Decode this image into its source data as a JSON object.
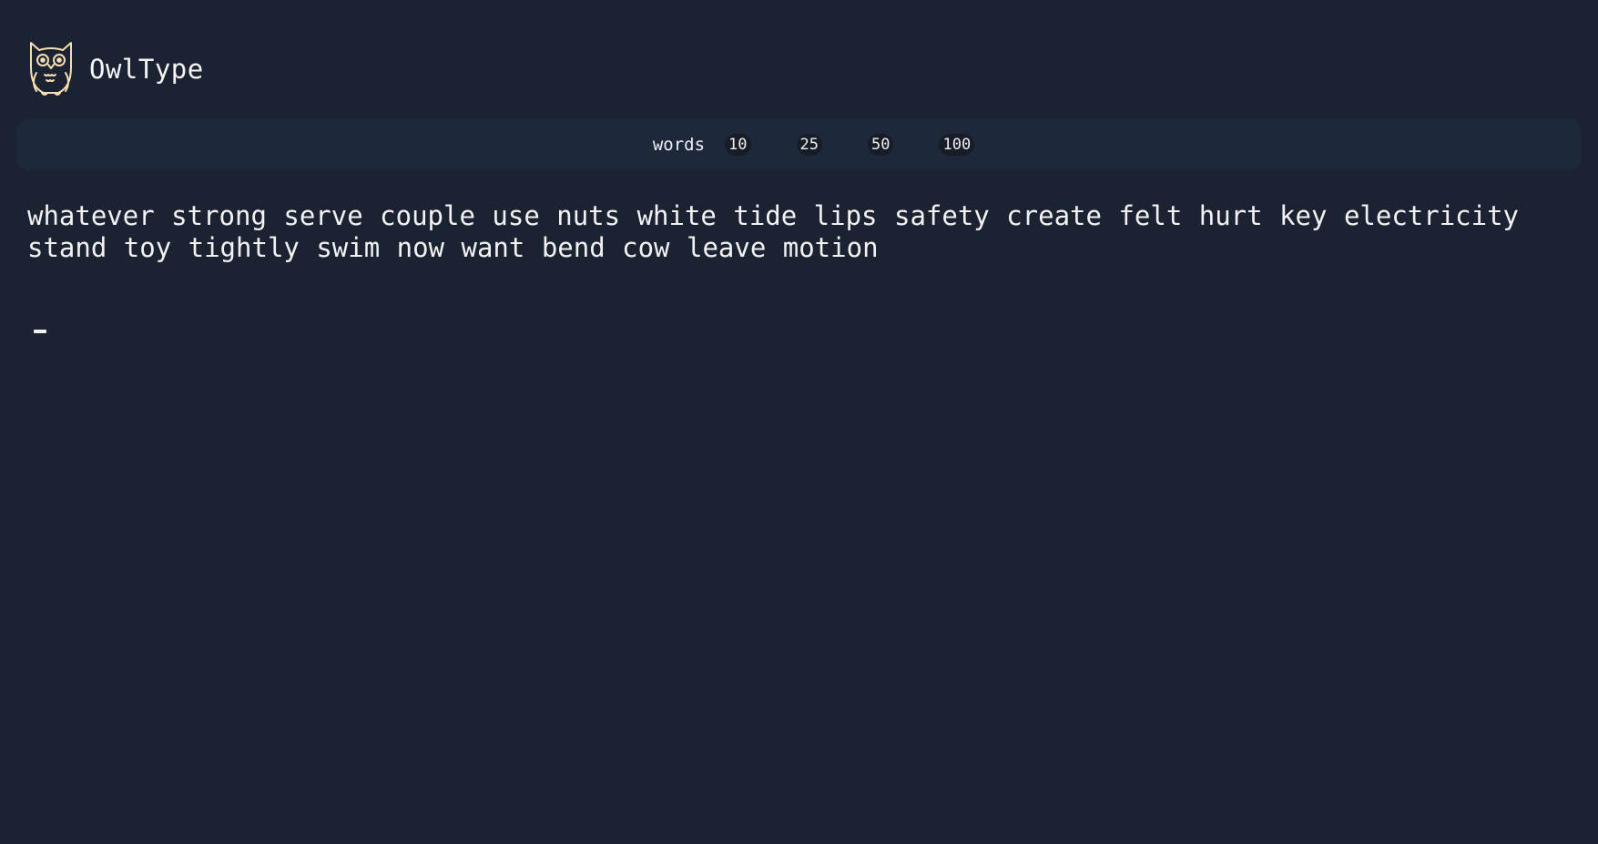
{
  "app": {
    "name": "OwlType",
    "logo_icon": "owl-icon",
    "accent_color": "#f5deb3",
    "background_color": "#1b2333"
  },
  "toolbar": {
    "mode_label": "words",
    "counts": [
      "10",
      "25",
      "50",
      "100"
    ]
  },
  "test": {
    "words": [
      "whatever",
      "strong",
      "serve",
      "couple",
      "use",
      "nuts",
      "white",
      "tide",
      "lips",
      "safety",
      "create",
      "felt",
      "hurt",
      "key",
      "electricity",
      "stand",
      "toy",
      "tightly",
      "swim",
      "now",
      "want",
      "bend",
      "cow",
      "leave",
      "motion"
    ]
  },
  "input": {
    "value": "",
    "caret_icon": "text-caret-icon"
  }
}
